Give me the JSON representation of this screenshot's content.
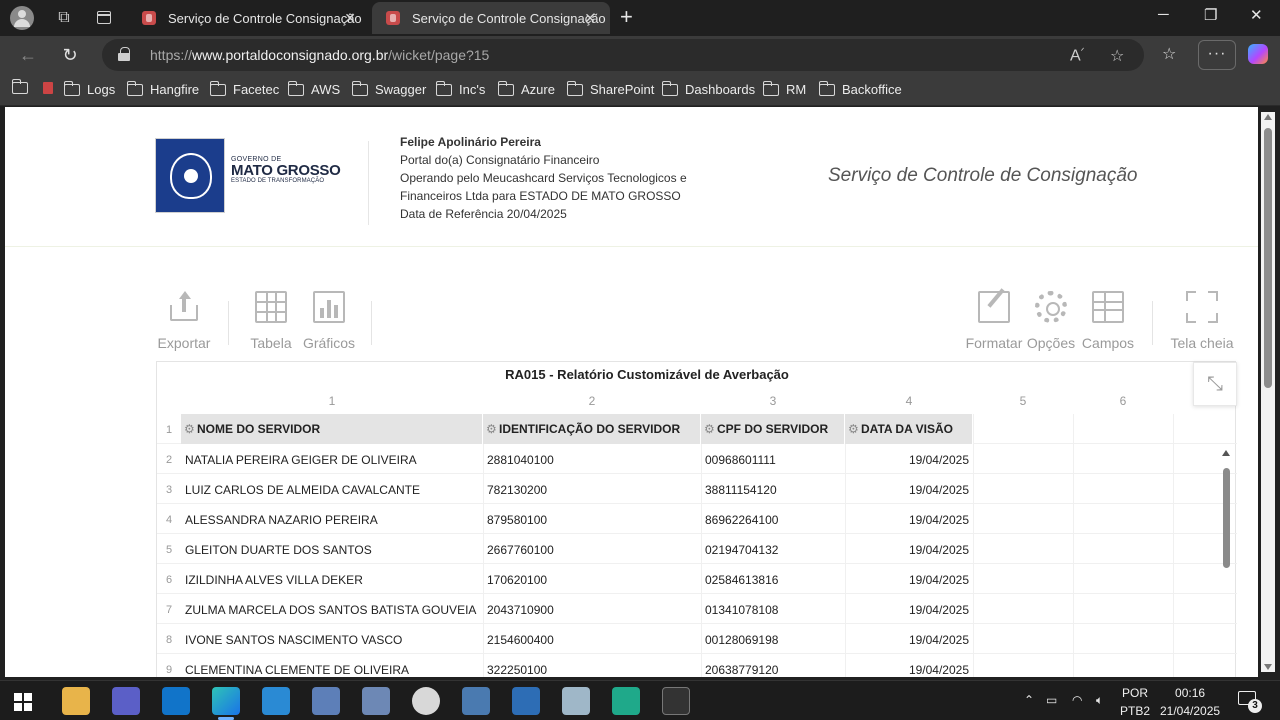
{
  "browser": {
    "tabs": [
      {
        "title": "Serviço de Controle Consignação"
      },
      {
        "title": "Serviço de Controle Consignação"
      }
    ],
    "url_prefix": "https://",
    "url_domain": "www.portaldoconsignado.org.br",
    "url_path": "/wicket/page?15",
    "bookmarks": [
      "Logs",
      "Hangfire",
      "Facetec",
      "AWS",
      "Swagger",
      "Inc's",
      "Azure",
      "SharePoint",
      "Dashboards",
      "RM",
      "Backoffice"
    ]
  },
  "header": {
    "logo": {
      "line1": "GOVERNO DE",
      "line2": "MATO GROSSO",
      "line3": "ESTADO DE TRANSFORMAÇÃO"
    },
    "user_name": "Felipe Apolinário Pereira",
    "portal": "Portal do(a) Consignatário Financeiro",
    "operating_line1": "Operando pelo Meucashcard Serviços Tecnologicos e",
    "operating_line2": "Financeiros Ltda para ESTADO DE MATO GROSSO",
    "reference_date": "Data de Referência 20/04/2025",
    "service_title": "Serviço de Controle de Consignação"
  },
  "toolbar": {
    "export": "Exportar",
    "table": "Tabela",
    "charts": "Gráficos",
    "format": "Formatar",
    "options": "Opções",
    "fields": "Campos",
    "fullscreen": "Tela cheia"
  },
  "report": {
    "title": "RA015 - Relatório Customizável de Averbação",
    "column_numbers": [
      "1",
      "2",
      "3",
      "4",
      "5",
      "6"
    ],
    "headers": [
      "NOME DO SERVIDOR",
      "IDENTIFICAÇÃO DO SERVIDOR",
      "CPF DO SERVIDOR",
      "DATA DA VISÃO"
    ],
    "header_row_number": "1",
    "rows": [
      {
        "n": "2",
        "name": "NATALIA PEREIRA GEIGER DE OLIVEIRA",
        "id": "2881040100",
        "cpf": "00968601111",
        "date": "19/04/2025"
      },
      {
        "n": "3",
        "name": "LUIZ CARLOS DE ALMEIDA CAVALCANTE",
        "id": "782130200",
        "cpf": "38811154120",
        "date": "19/04/2025"
      },
      {
        "n": "4",
        "name": "ALESSANDRA NAZARIO PEREIRA",
        "id": "879580100",
        "cpf": "86962264100",
        "date": "19/04/2025"
      },
      {
        "n": "5",
        "name": "GLEITON DUARTE DOS SANTOS",
        "id": "2667760100",
        "cpf": "02194704132",
        "date": "19/04/2025"
      },
      {
        "n": "6",
        "name": "IZILDINHA ALVES VILLA DEKER",
        "id": "170620100",
        "cpf": "02584613816",
        "date": "19/04/2025"
      },
      {
        "n": "7",
        "name": "ZULMA MARCELA DOS SANTOS BATISTA GOUVEIA",
        "id": "2043710900",
        "cpf": "01341078108",
        "date": "19/04/2025"
      },
      {
        "n": "8",
        "name": "IVONE SANTOS NASCIMENTO VASCO",
        "id": "2154600400",
        "cpf": "00128069198",
        "date": "19/04/2025"
      },
      {
        "n": "9",
        "name": "CLEMENTINA CLEMENTE DE OLIVEIRA",
        "id": "322250100",
        "cpf": "20638779120",
        "date": "19/04/2025"
      }
    ]
  },
  "taskbar": {
    "lang1": "POR",
    "lang2": "PTB2",
    "time": "00:16",
    "date": "21/04/2025",
    "notifications": "3"
  }
}
